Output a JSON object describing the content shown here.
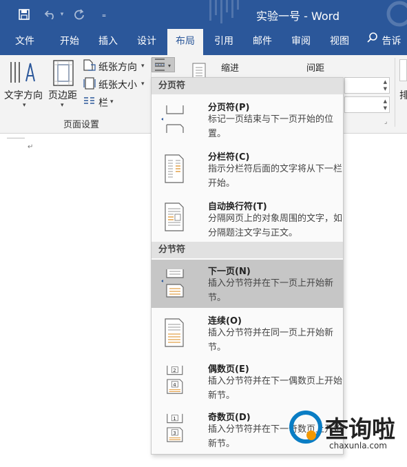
{
  "window": {
    "title": "实验一号 - Word"
  },
  "tabs": [
    "文件",
    "开始",
    "插入",
    "设计",
    "布局",
    "引用",
    "邮件",
    "审阅",
    "视图"
  ],
  "active_tab": "布局",
  "tell_me": "告诉",
  "ribbon": {
    "text_direction": "文字方向",
    "margins": "页边距",
    "orientation": "纸张方向",
    "size": "纸张大小",
    "columns": "栏",
    "indent": "缩进",
    "spacing": "间距",
    "group_page_setup": "页面设置",
    "arrange_partial": "排"
  },
  "menu": {
    "page_breaks_header": "分页符",
    "section_breaks_header": "分节符",
    "items": [
      {
        "title": "分页符(P)",
        "desc": "标记一页结束与下一页开始的位置。",
        "icon": "page-break-icon"
      },
      {
        "title": "分栏符(C)",
        "desc": "指示分栏符后面的文字将从下一栏开始。",
        "icon": "column-break-icon"
      },
      {
        "title": "自动换行符(T)",
        "desc": "分隔网页上的对象周围的文字，如分隔题注文字与正文。",
        "icon": "text-wrapping-break-icon"
      },
      {
        "title": "下一页(N)",
        "desc": "插入分节符并在下一页上开始新节。",
        "icon": "next-page-icon"
      },
      {
        "title": "连续(O)",
        "desc": "插入分节符并在同一页上开始新节。",
        "icon": "continuous-icon"
      },
      {
        "title": "偶数页(E)",
        "desc": "插入分节符并在下一偶数页上开始新节。",
        "icon": "even-page-icon"
      },
      {
        "title": "奇数页(D)",
        "desc": "插入分节符并在下一奇数页上开始新节。",
        "icon": "odd-page-icon"
      }
    ],
    "highlighted": "下一页(N)"
  },
  "document": {
    "pilcrow": "↵"
  },
  "watermark": {
    "brand": "查询啦",
    "url": "chaxunla.com"
  },
  "colors": {
    "title_bar": "#2b579a",
    "ribbon": "#f3f3f3",
    "highlight": "#c6c6c6",
    "watermark_blue": "#0a7dc4",
    "watermark_orange": "#f39800"
  }
}
